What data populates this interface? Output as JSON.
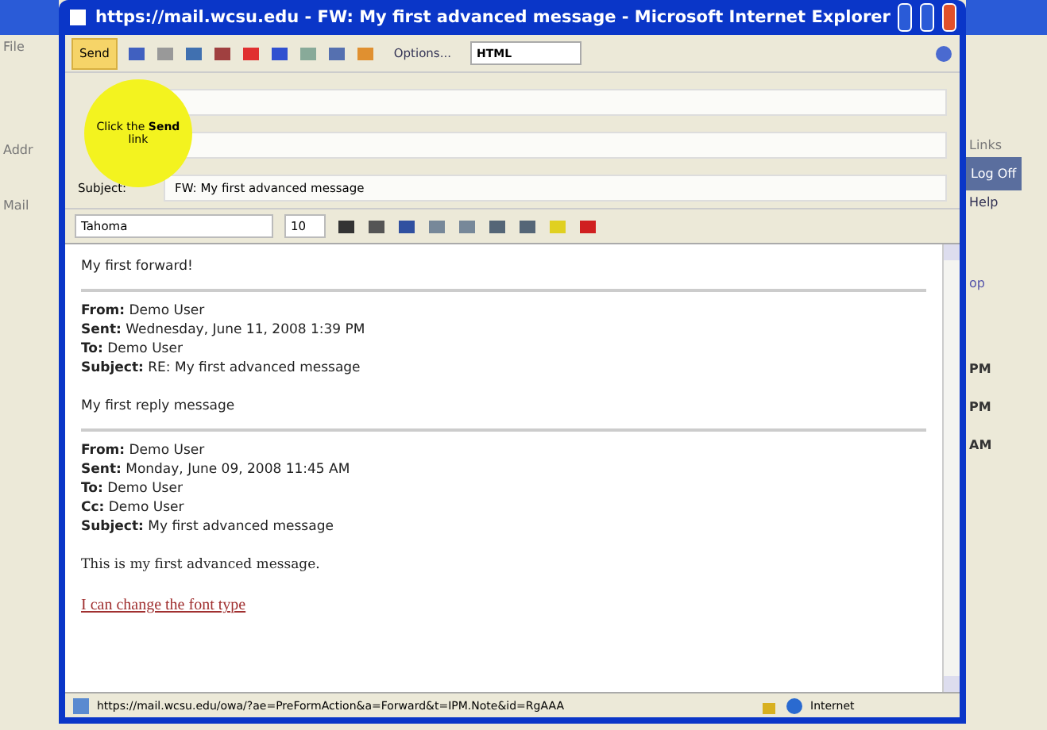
{
  "background_window": {
    "menu": "File",
    "address_label": "Addr",
    "links": "Links",
    "log_off": "Log Off",
    "mail_label": "Mail",
    "help": "Help",
    "column_heading": "op",
    "times": [
      "PM",
      "PM",
      "AM"
    ]
  },
  "window": {
    "title": "https://mail.wcsu.edu - FW: My first advanced message - Microsoft Internet Explorer"
  },
  "toolbar": {
    "send": "Send",
    "options": "Options...",
    "format": "HTML"
  },
  "callout": {
    "text": "Click the **Send** link"
  },
  "fields": {
    "subject_label": "Subject:",
    "subject": "FW: My first advanced message"
  },
  "format_bar": {
    "font": "Tahoma",
    "size": "10"
  },
  "body": {
    "first_line": "My first forward!",
    "blocks": [
      {
        "headers": [
          {
            "label": "From:",
            "value": "Demo User"
          },
          {
            "label": "Sent:",
            "value": "Wednesday, June 11, 2008 1:39 PM"
          },
          {
            "label": "To:",
            "value": "Demo User"
          },
          {
            "label": "Subject:",
            "value": "RE: My first advanced message"
          }
        ],
        "text": "My first reply message"
      },
      {
        "headers": [
          {
            "label": "From:",
            "value": "Demo User"
          },
          {
            "label": "Sent:",
            "value": "Monday, June 09, 2008 11:45 AM"
          },
          {
            "label": "To:",
            "value": "Demo User"
          },
          {
            "label": "Cc:",
            "value": "Demo User"
          },
          {
            "label": "Subject:",
            "value": "My first advanced message"
          }
        ],
        "text": "This is my first advanced message."
      }
    ],
    "link": "I can change the font type"
  },
  "status_bar": {
    "url": "https://mail.wcsu.edu/owa/?ae=PreFormAction&a=Forward&t=IPM.Note&id=RgAAA",
    "zone": "Internet"
  }
}
